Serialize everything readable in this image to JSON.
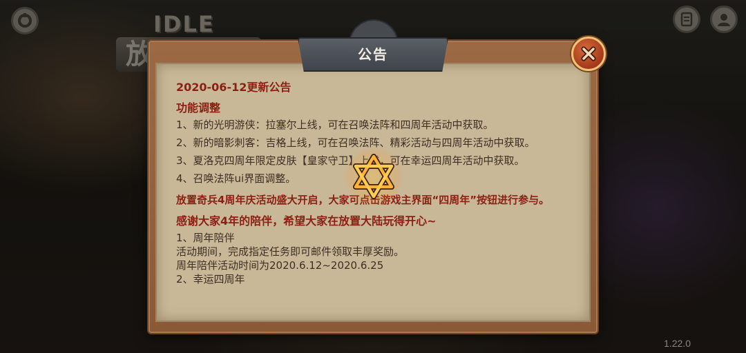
{
  "header": {
    "dialog_title": "公告"
  },
  "version": "1.22.0",
  "announcement": {
    "date_title": "2020-06-12更新公告",
    "feature_heading": "功能调整",
    "feature_items": [
      "1、新的光明游侠：拉塞尔上线，可在召唤法阵和四周年活动中获取。",
      "2、新的暗影刺客：吉格上线，可在召唤法阵、精彩活动与四周年活动中获取。",
      "3、夏洛克四周年限定皮肤【皇家守卫】上线，可在幸运四周年活动中获取。",
      "4、召唤法阵ui界面调整。"
    ],
    "event_heading": "放置奇兵4周年庆活动盛大开启，大家可点击游戏主界面“四周年”按钮进行参与。",
    "thanks_heading": "感谢大家4年的陪伴，希望大家在放置大陆玩得开心~",
    "section1_title": "1、周年陪伴",
    "section1_desc": "活动期间，完成指定任务即可邮件领取丰厚奖励。",
    "section1_time": "周年陪伴活动时间为2020.6.12~2020.6.25",
    "section2_title": "2、幸运四周年"
  },
  "icons": {
    "top_left": "settings-icon",
    "top_right_1": "document-icon",
    "top_right_2": "user-avatar-icon",
    "close": "close-x-icon",
    "spinner": "hexagram-loading-icon"
  },
  "colors": {
    "heading_red": "#8c1f12",
    "body_text": "#3c2e22",
    "paper": "#c9b898",
    "frame": "#8a5a37",
    "close_button": "#a4391b",
    "spinner_gold": "#ffb23a"
  }
}
